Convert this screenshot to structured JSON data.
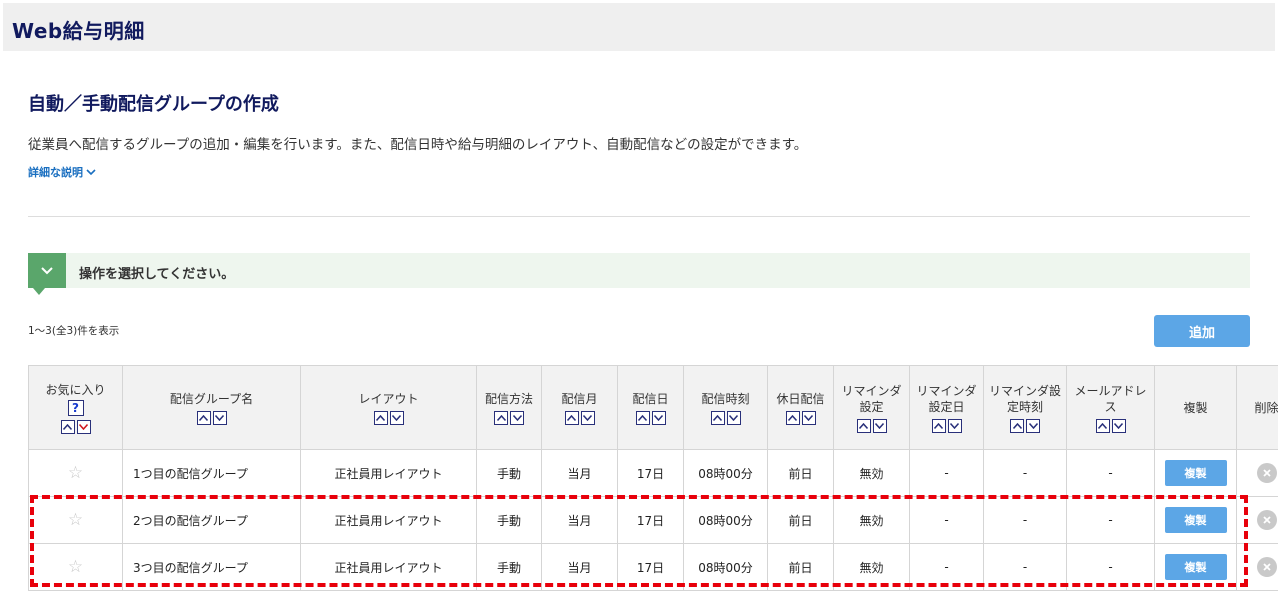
{
  "app": {
    "title": "Web給与明細"
  },
  "page": {
    "title": "自動／手動配信グループの作成",
    "description": "従業員へ配信するグループの追加・編集を行います。また、配信日時や給与明細のレイアウト、自動配信などの設定ができます。",
    "detail_link": "詳細な説明"
  },
  "operation": {
    "label": "操作を選択してください。"
  },
  "list": {
    "count_text": "1～3(全3)件を表示",
    "add_label": "追加",
    "help_glyph": "?"
  },
  "table": {
    "headers": {
      "favorite": "お気に入り",
      "group_name": "配信グループ名",
      "layout": "レイアウト",
      "method": "配信方法",
      "month": "配信月",
      "day": "配信日",
      "time": "配信時刻",
      "holiday": "休日配信",
      "reminder": "リマインダ設定",
      "reminder_day": "リマインダ設定日",
      "reminder_time": "リマインダ設定時刻",
      "mail": "メールアドレス",
      "duplicate": "複製",
      "delete": "削除"
    },
    "rows": [
      {
        "name": "1つ目の配信グループ",
        "layout": "正社員用レイアウト",
        "method": "手動",
        "month": "当月",
        "day": "17日",
        "time": "08時00分",
        "holiday": "前日",
        "reminder": "無効",
        "reminder_day": "-",
        "reminder_time": "-",
        "mail": "-",
        "duplicate_label": "複製"
      },
      {
        "name": "2つ目の配信グループ",
        "layout": "正社員用レイアウト",
        "method": "手動",
        "month": "当月",
        "day": "17日",
        "time": "08時00分",
        "holiday": "前日",
        "reminder": "無効",
        "reminder_day": "-",
        "reminder_time": "-",
        "mail": "-",
        "duplicate_label": "複製"
      },
      {
        "name": "3つ目の配信グループ",
        "layout": "正社員用レイアウト",
        "method": "手動",
        "month": "当月",
        "day": "17日",
        "time": "08時00分",
        "holiday": "前日",
        "reminder": "無効",
        "reminder_day": "-",
        "reminder_time": "-",
        "mail": "-",
        "duplicate_label": "複製"
      }
    ]
  },
  "colors": {
    "title_navy": "#111a5e",
    "link_blue": "#1a6fc0",
    "button_blue": "#5ca6e6",
    "op_green": "#5aa66b",
    "highlight_red": "#e8000b"
  }
}
